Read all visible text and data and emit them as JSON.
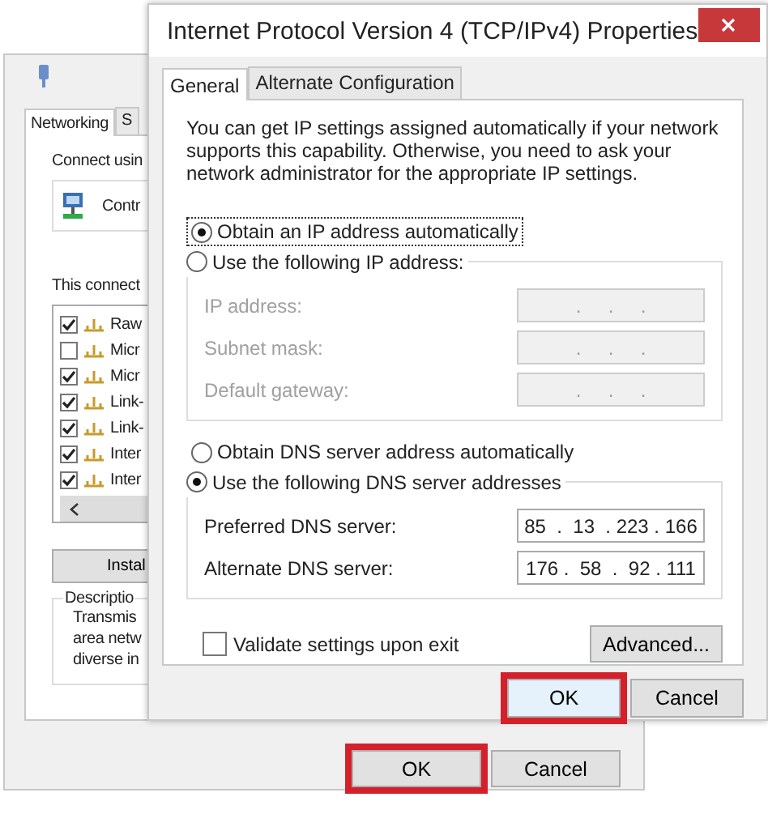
{
  "background_window": {
    "tabs": [
      {
        "label": "Networking",
        "selected": true
      },
      {
        "label": "S",
        "selected": false
      }
    ],
    "connect_using_label": "Connect usin",
    "adapter": "Contr",
    "components_label": "This connect",
    "components": [
      {
        "name": "Raw",
        "checked": true
      },
      {
        "name": "Micr",
        "checked": false
      },
      {
        "name": "Micr",
        "checked": true
      },
      {
        "name": "Link-",
        "checked": true
      },
      {
        "name": "Link-",
        "checked": true
      },
      {
        "name": "Inter",
        "checked": true
      },
      {
        "name": "Inter",
        "checked": true
      }
    ],
    "install_button": "Instal",
    "description": {
      "title": "Descriptio",
      "lines": [
        "Transmis",
        "area netw",
        "diverse in"
      ]
    },
    "buttons": [
      {
        "label": "OK",
        "highlighted": true
      },
      {
        "label": "Cancel",
        "highlighted": false
      }
    ]
  },
  "dialog": {
    "title": "Internet Protocol Version 4 (TCP/IPv4) Properties",
    "tabs": [
      {
        "label": "General",
        "selected": true
      },
      {
        "label": "Alternate Configuration",
        "selected": false
      }
    ],
    "intro": "You can get IP settings assigned automatically if your network supports this capability. Otherwise, you need to ask your network administrator for the appropriate IP settings.",
    "ip_options": [
      {
        "label": "Obtain an IP address automatically",
        "selected": true,
        "focused": true
      },
      {
        "label": "Use the following IP address:",
        "selected": false,
        "focused": false
      }
    ],
    "ip_fields": [
      {
        "label": "IP address:",
        "value": ".     .     .",
        "disabled": true
      },
      {
        "label": "Subnet mask:",
        "value": ".     .     .",
        "disabled": true
      },
      {
        "label": "Default gateway:",
        "value": ".     .     .",
        "disabled": true
      }
    ],
    "dns_options": [
      {
        "label": "Obtain DNS server address automatically",
        "selected": false,
        "focused": false
      },
      {
        "label": "Use the following DNS server addresses",
        "selected": true,
        "focused": false
      }
    ],
    "dns_fields": [
      {
        "label": "Preferred DNS server:",
        "value": "85  .  13  . 223 . 166",
        "disabled": false
      },
      {
        "label": "Alternate DNS server:",
        "value": "176 .  58  .  92 . 111",
        "disabled": false
      }
    ],
    "validate": {
      "label": "Validate settings upon exit",
      "checked": false
    },
    "advanced_button": "Advanced...",
    "buttons": [
      {
        "label": "OK",
        "highlighted": true
      },
      {
        "label": "Cancel",
        "highlighted": false
      }
    ]
  }
}
